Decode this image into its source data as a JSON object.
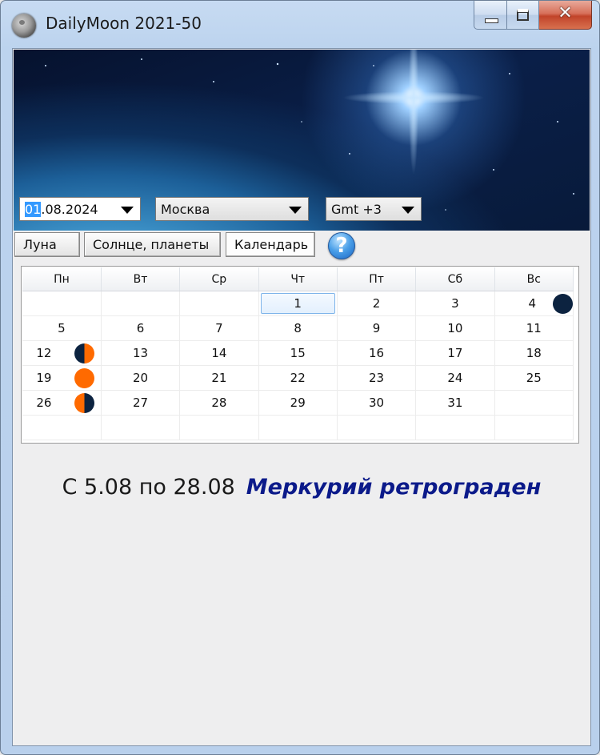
{
  "window": {
    "title": "DailyMoon 2021-50"
  },
  "controls": {
    "date": {
      "selected": "01",
      "rest": ".08.2024"
    },
    "city": "Москва",
    "timezone": "Gmt +3"
  },
  "tabs": [
    "Луна",
    "Солнце, планеты",
    "Календарь"
  ],
  "help_label": "?",
  "calendar": {
    "weekdays": [
      "Пн",
      "Вт",
      "Ср",
      "Чт",
      "Пт",
      "Сб",
      "Вс"
    ],
    "weeks": [
      [
        "",
        "",
        "",
        "1",
        "2",
        "3",
        "4"
      ],
      [
        "5",
        "6",
        "7",
        "8",
        "9",
        "10",
        "11"
      ],
      [
        "12",
        "13",
        "14",
        "15",
        "16",
        "17",
        "18"
      ],
      [
        "19",
        "20",
        "21",
        "22",
        "23",
        "24",
        "25"
      ],
      [
        "26",
        "27",
        "28",
        "29",
        "30",
        "31",
        ""
      ],
      [
        "",
        "",
        "",
        "",
        "",
        "",
        ""
      ]
    ],
    "today": "1",
    "moon_phases": {
      "4": "new-moon",
      "12": "first-quarter",
      "19": "full-moon",
      "26": "last-quarter"
    },
    "colors": {
      "moon_dark": "#0c2340",
      "moon_lit": "#ff6a00"
    }
  },
  "event": {
    "range": "С 5.08 по 28.08",
    "text": "Меркурий ретрограден"
  }
}
